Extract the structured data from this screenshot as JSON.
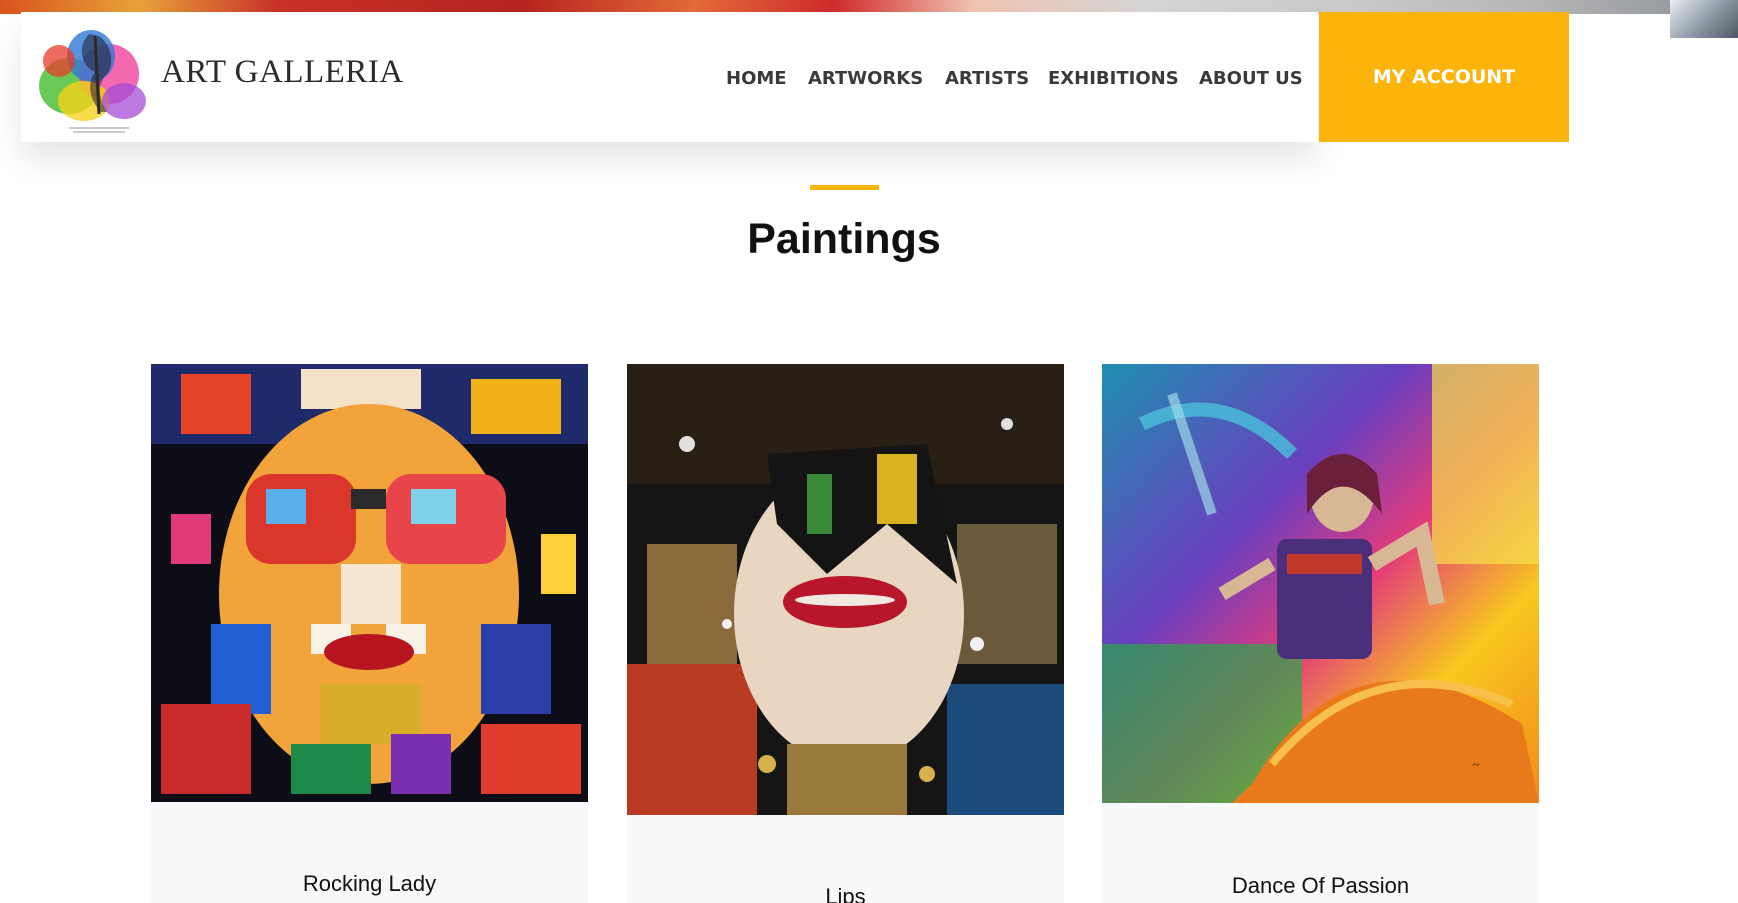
{
  "site": {
    "brand": "ART GALLERIA",
    "logo_icon": "painted-face-logo-icon"
  },
  "nav": {
    "items": [
      {
        "label": "HOME"
      },
      {
        "label": "ARTWORKS"
      },
      {
        "label": "ARTISTS"
      },
      {
        "label": "EXHIBITIONS"
      },
      {
        "label": "ABOUT US"
      }
    ],
    "account_label": "MY ACCOUNT"
  },
  "section": {
    "title": "Paintings"
  },
  "cards": [
    {
      "title": "Rocking Lady"
    },
    {
      "title": "Lips"
    },
    {
      "title": "Dance Of Passion"
    }
  ],
  "colors": {
    "accent": "#fbb40c",
    "card_bg": "#f7f8fa",
    "text": "#111111",
    "nav_text": "#3a3a3a"
  }
}
